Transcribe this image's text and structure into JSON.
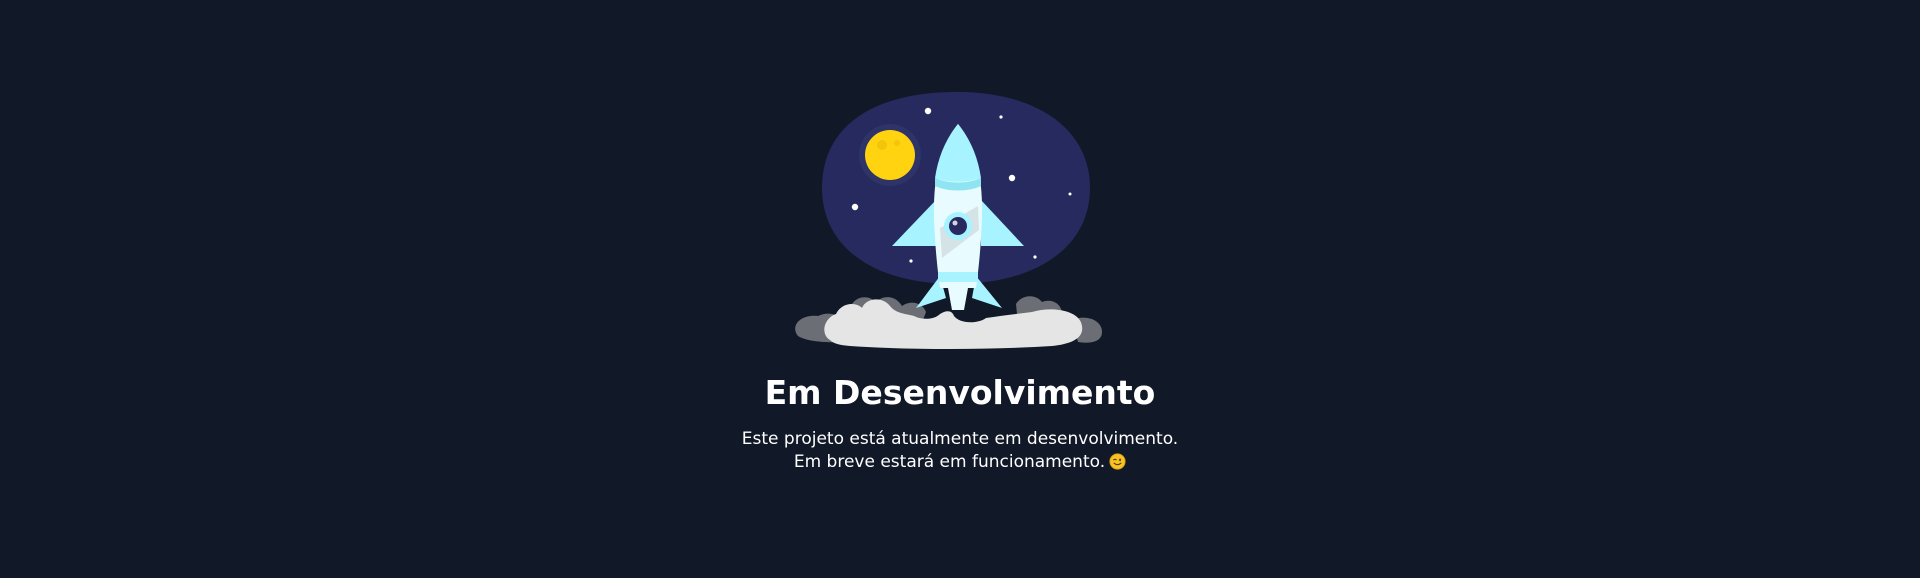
{
  "page": {
    "title": "Em Desenvolvimento",
    "message_line_1": "Este projeto está atualmente em desenvolvimento.",
    "message_line_2": "Em breve estará em funcionamento."
  },
  "illustration": {
    "subject": "rocket-launch",
    "colors": {
      "background": "#111827",
      "sky": "#262a5e",
      "moon": "#ffd30f",
      "rocket_body": "#e8fbff",
      "rocket_accent": "#a7f3ff",
      "smoke_light": "#e5e5e5",
      "smoke_dark": "#6b6e75"
    }
  },
  "icons": {
    "emoji": "winking-face-icon"
  }
}
